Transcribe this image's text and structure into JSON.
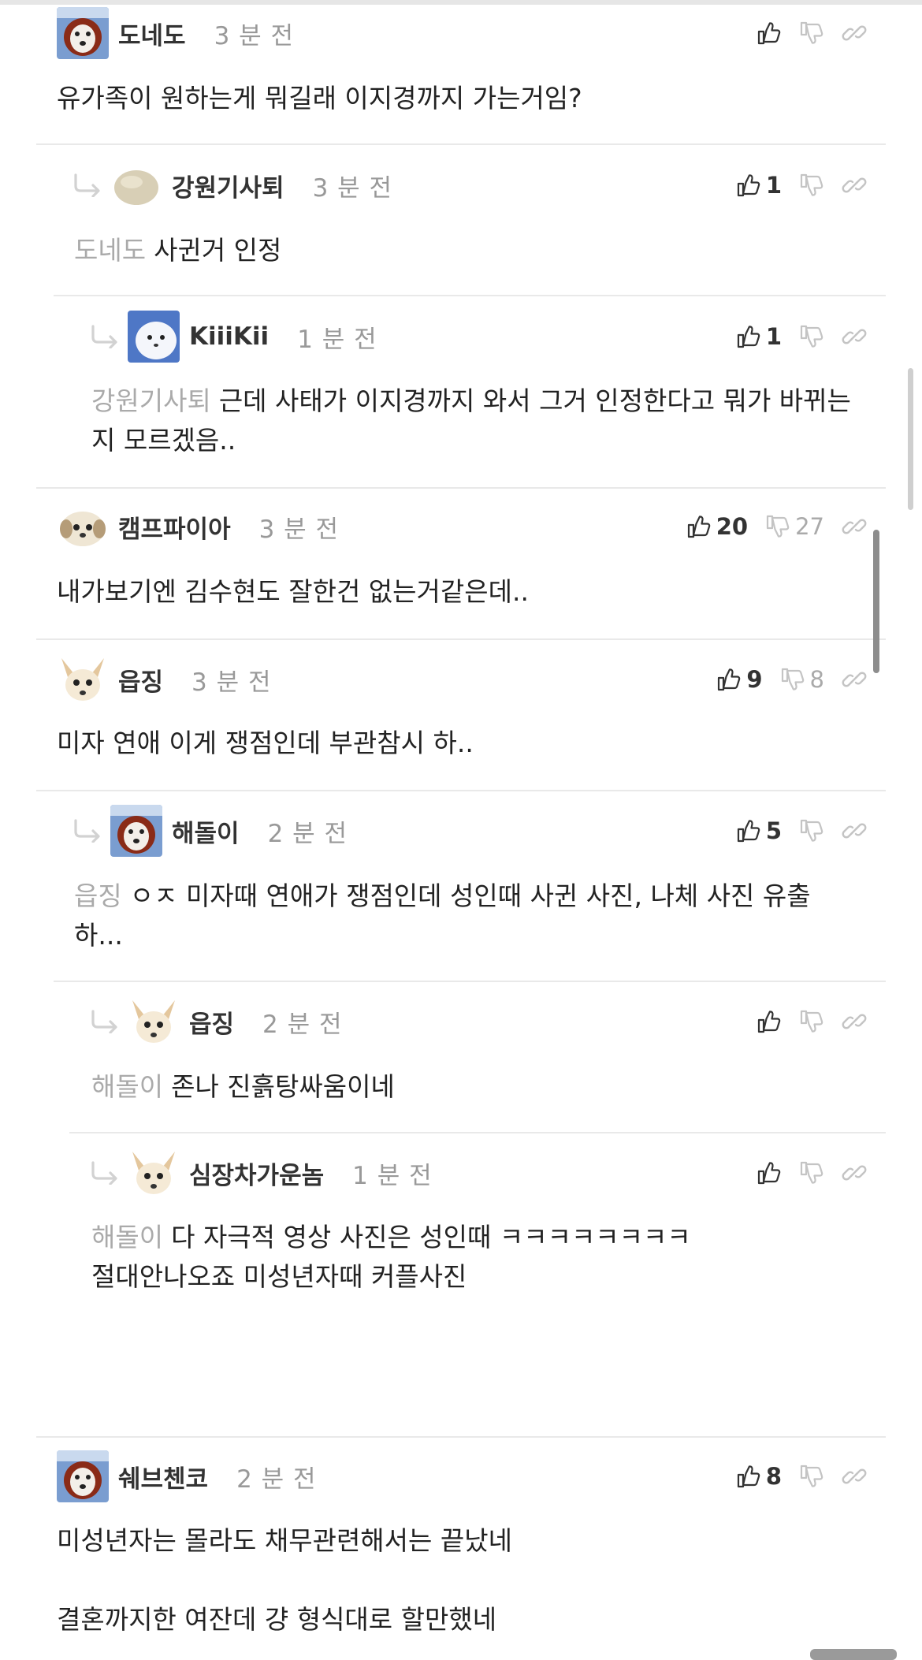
{
  "comments": [
    {
      "nick": "도네도",
      "time": "3 분 전",
      "up": "",
      "down": "",
      "text": "유가족이 원하는게 뭐길래 이지경까지 가는거임?"
    },
    {
      "nick": "강원기사퇴",
      "time": "3 분 전",
      "up": "1",
      "down": "",
      "mention": "도네도",
      "text": "사귄거 인정"
    },
    {
      "nick": "KiiiKii",
      "time": "1 분 전",
      "up": "1",
      "down": "",
      "mention": "강원기사퇴",
      "text": "근데 사태가 이지경까지 와서 그거 인정한다고 뭐가 바뀌는지 모르겠음.."
    },
    {
      "nick": "캠프파이아",
      "time": "3 분 전",
      "up": "20",
      "down": "27",
      "text": "내가보기엔 김수현도 잘한건 없는거같은데.."
    },
    {
      "nick": "읍징",
      "time": "3 분 전",
      "up": "9",
      "down": "8",
      "text": "미자 연애 이게 쟁점인데 부관참시 하.."
    },
    {
      "nick": "해돌이",
      "time": "2 분 전",
      "up": "5",
      "down": "",
      "mention": "읍징",
      "text": "ㅇㅈ 미자때 연애가 쟁점인데 성인때 사귄 사진, 나체 사진 유출 하..."
    },
    {
      "nick": "읍징",
      "time": "2 분 전",
      "up": "",
      "down": "",
      "mention": "해돌이",
      "text": "존나 진흙탕싸움이네"
    },
    {
      "nick": "심장차가운놈",
      "time": "1 분 전",
      "up": "",
      "down": "",
      "mention": "해돌이",
      "text": "다 자극적 영상 사진은 성인때 ㅋㅋㅋㅋㅋㅋㅋㅋ",
      "text2": "절대안나오죠 미성년자때 커플사진"
    },
    {
      "nick": "쉐브첸코",
      "time": "2 분 전",
      "up": "8",
      "down": "",
      "text": "미성년자는 몰라도 채무관련해서는 끝났네",
      "text2": "결혼까지한 여잔데 걍 형식대로 할만했네"
    }
  ]
}
